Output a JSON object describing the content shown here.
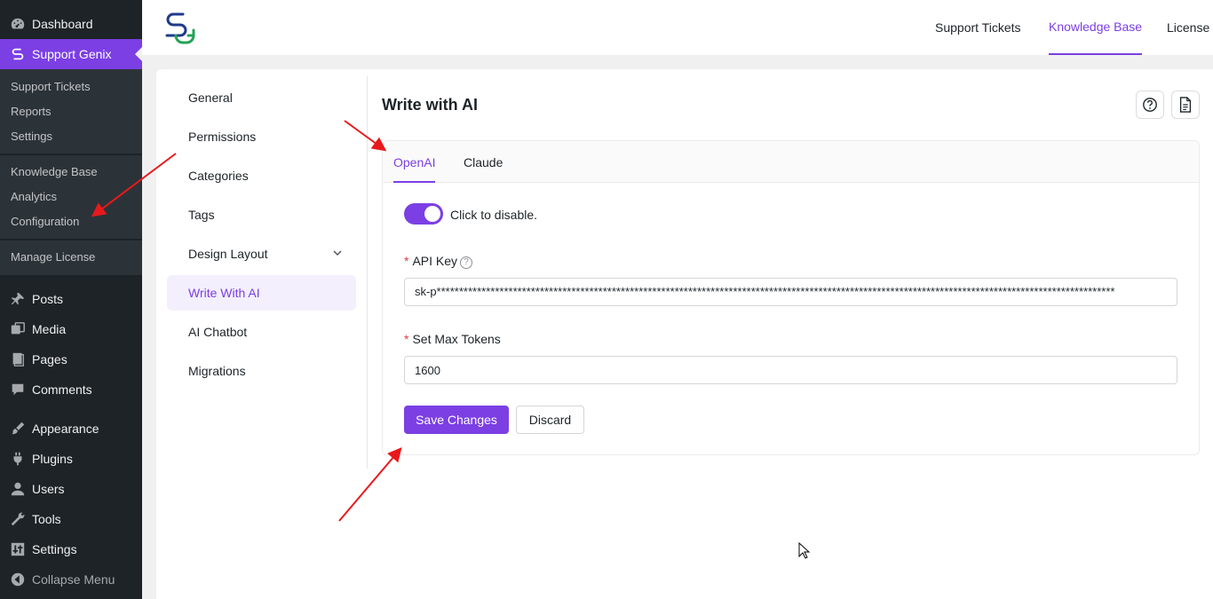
{
  "sidebar": {
    "dashboard": "Dashboard",
    "support_genix": "Support Genix",
    "sub": [
      "Support Tickets",
      "Reports",
      "Settings",
      "Knowledge Base",
      "Analytics",
      "Configuration",
      "Manage License"
    ],
    "items": [
      "Posts",
      "Media",
      "Pages",
      "Comments",
      "Appearance",
      "Plugins",
      "Users",
      "Tools",
      "Settings",
      "Collapse Menu"
    ]
  },
  "header": {
    "nav": [
      "Support Tickets",
      "Knowledge Base",
      "License"
    ],
    "active_nav": "Knowledge Base"
  },
  "leftnav": {
    "items": [
      "General",
      "Permissions",
      "Categories",
      "Tags",
      "Design Layout",
      "Write With AI",
      "AI Chatbot",
      "Migrations"
    ],
    "active": "Write With AI"
  },
  "main": {
    "title": "Write with AI",
    "tabs": [
      "OpenAI",
      "Claude"
    ],
    "active_tab": "OpenAI",
    "toggle_label": "Click to disable.",
    "api_key_label": "API Key",
    "api_key_value": "sk-p*******************************************************************************************************************************************************",
    "max_tokens_label": "Set Max Tokens",
    "max_tokens_value": "1600",
    "save_label": "Save Changes",
    "discard_label": "Discard",
    "required_mark": "*"
  },
  "colors": {
    "accent": "#7b3fe4",
    "sidebar_bg": "#1d2327",
    "annotation_arrow": "#e8191c"
  }
}
